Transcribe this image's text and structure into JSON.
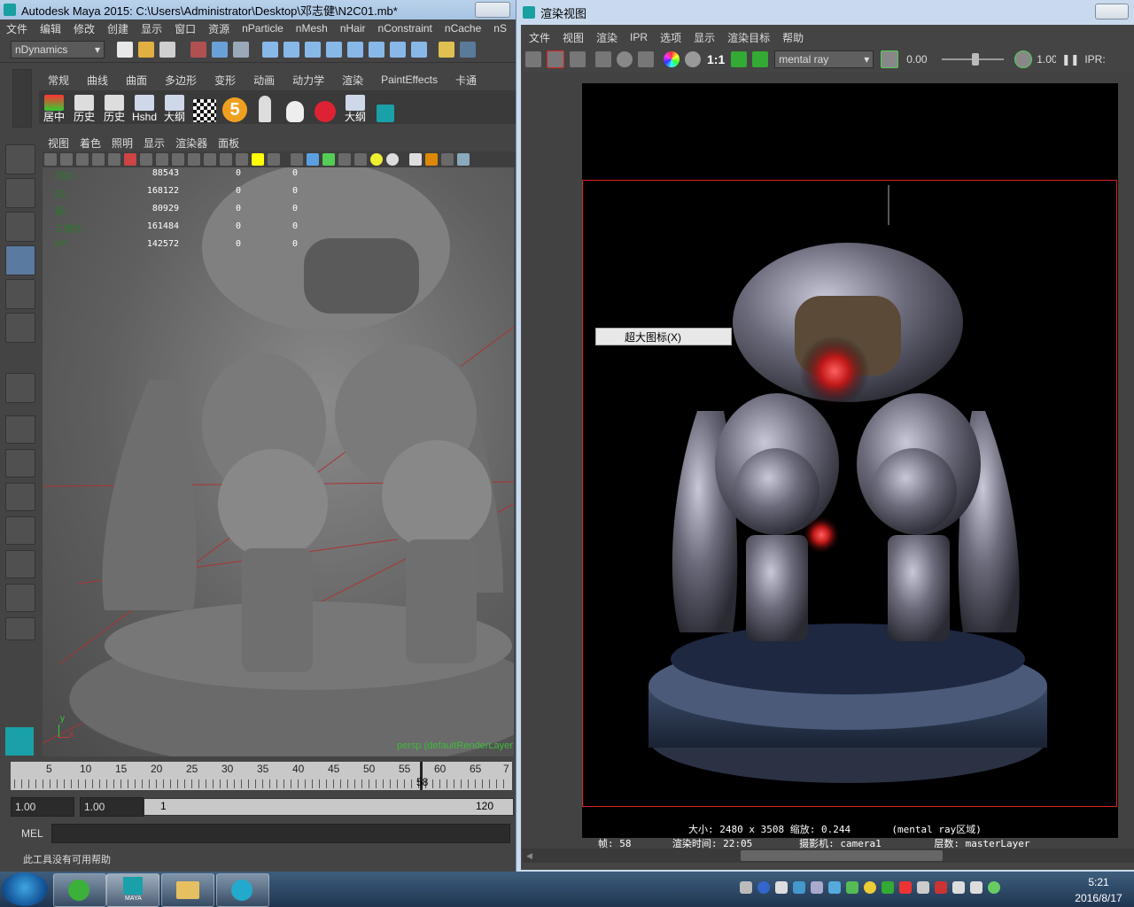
{
  "maya": {
    "title": "Autodesk Maya 2015: C:\\Users\\Administrator\\Desktop\\邓志健\\N2C01.mb*",
    "menu": [
      "文件",
      "编辑",
      "修改",
      "创建",
      "显示",
      "窗口",
      "资源",
      "nParticle",
      "nMesh",
      "nHair",
      "nConstraint",
      "nCache",
      "nS"
    ],
    "menuset": "nDynamics",
    "shelf_tabs": [
      "常规",
      "曲线",
      "曲面",
      "多边形",
      "变形",
      "动画",
      "动力学",
      "渲染",
      "PaintEffects",
      "卡通"
    ],
    "shelf_items": [
      "居中",
      "历史",
      "历史",
      "Hshd",
      "大纲",
      "",
      "5",
      "",
      "",
      "",
      "大纲",
      ""
    ],
    "panel_menu": [
      "视图",
      "着色",
      "照明",
      "显示",
      "渲染器",
      "面板"
    ],
    "hud": {
      "rows": [
        {
          "k": "顶点:",
          "v": "88543",
          "c": "0",
          "d": "0"
        },
        {
          "k": "边:",
          "v": "168122",
          "c": "0",
          "d": "0"
        },
        {
          "k": "面:",
          "v": "80929",
          "c": "0",
          "d": "0"
        },
        {
          "k": "三角形:",
          "v": "161484",
          "c": "0",
          "d": "0"
        },
        {
          "k": "UV:",
          "v": "142572",
          "c": "0",
          "d": "0"
        }
      ]
    },
    "camera_label": "persp (defaultRenderLayer",
    "axis_y": "y",
    "axis_x": "x",
    "time_ticks": [
      "5",
      "10",
      "15",
      "20",
      "25",
      "30",
      "35",
      "40",
      "45",
      "50",
      "55",
      "60",
      "65",
      "7"
    ],
    "current_frame": "58",
    "range_start": "1.00",
    "range_start2": "1.00",
    "range_inner_start": "1",
    "range_inner_end": "120",
    "cmd_label": "MEL",
    "help_text": "此工具没有可用帮助"
  },
  "render_view": {
    "title": "渲染视图",
    "menu": [
      "文件",
      "视图",
      "渲染",
      "IPR",
      "选项",
      "显示",
      "渲染目标",
      "帮助"
    ],
    "ratio_label": "1:1",
    "renderer": "mental ray",
    "exposure": "0.00",
    "gamma": "1.00",
    "ipr_label": "IPR:",
    "context_menu_item": "超大图标(X)",
    "info_line1": "大小: 2480 x 3508 缩放: 0.244       (mental ray区域)",
    "info_line2": "帧: 58       渲染时间: 22:05        摄影机: camera1         层数: masterLayer"
  },
  "taskbar": {
    "time": "5:21",
    "date": "2016/8/17",
    "maya_label": "MAYA"
  },
  "colors": {
    "maya_bg": "#444444",
    "render_region": "#dd2222",
    "hud_key": "#2a7a2a",
    "camera_label": "#3dbb3d"
  }
}
